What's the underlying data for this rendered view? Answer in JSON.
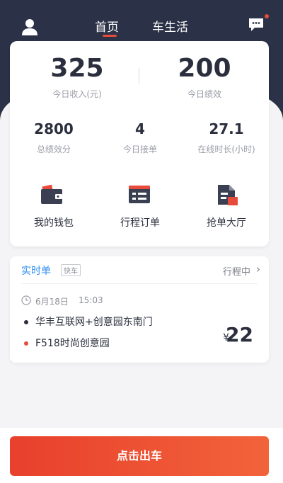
{
  "header": {
    "tabs": [
      {
        "label": "首页",
        "active": true
      },
      {
        "label": "车生活",
        "active": false
      }
    ],
    "has_message_badge": true
  },
  "stats": {
    "income": {
      "value": "325",
      "label": "今日收入(元)"
    },
    "performance": {
      "value": "200",
      "label": "今日绩效"
    },
    "small": [
      {
        "value": "2800",
        "label": "总绩效分"
      },
      {
        "value": "4",
        "label": "今日接单"
      },
      {
        "value": "27.1",
        "label": "在线时长(小时)"
      }
    ]
  },
  "menu": [
    {
      "label": "我的钱包",
      "icon": "wallet-icon"
    },
    {
      "label": "行程订单",
      "icon": "trip-order-icon"
    },
    {
      "label": "抢单大厅",
      "icon": "grab-order-icon"
    }
  ],
  "order": {
    "type": "实时单",
    "tag": "快车",
    "status": "行程中",
    "date": "6月18日",
    "time": "15:03",
    "start": "华丰互联网+创意园东南门",
    "end": "F518时尚创意园",
    "currency": "¥",
    "price": "22"
  },
  "cta": {
    "label": "点击出车"
  },
  "colors": {
    "header_bg": "#2b3146",
    "accent_red": "#e64b3b",
    "accent_blue": "#2f8ef0",
    "cta_start": "#e8402d",
    "cta_end": "#f2633a"
  }
}
